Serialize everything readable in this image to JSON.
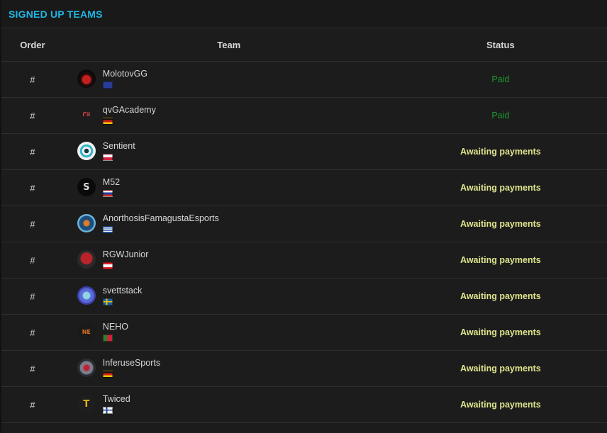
{
  "panel": {
    "title": "SIGNED UP TEAMS"
  },
  "columns": {
    "order": "Order",
    "team": "Team",
    "status": "Status"
  },
  "teams": [
    {
      "order": "#",
      "name": "MolotovGG",
      "logo": "molotov-logo",
      "flag": "eu-flag",
      "status": "Paid",
      "status_type": "paid"
    },
    {
      "order": "#",
      "name": "qvGAcademy",
      "logo": "qvg-logo",
      "flag": "germany-flag",
      "status": "Paid",
      "status_type": "paid"
    },
    {
      "order": "#",
      "name": "Sentient",
      "logo": "sentient-logo",
      "flag": "poland-flag",
      "status": "Awaiting payments",
      "status_type": "await"
    },
    {
      "order": "#",
      "name": "M52",
      "logo": "m52-logo",
      "flag": "russia-flag",
      "status": "Awaiting payments",
      "status_type": "await"
    },
    {
      "order": "#",
      "name": "AnorthosisFamagustaEsports",
      "logo": "anorthosis-logo",
      "flag": "greece-flag",
      "status": "Awaiting payments",
      "status_type": "await"
    },
    {
      "order": "#",
      "name": "RGWJunior",
      "logo": "rgw-logo",
      "flag": "lebanon-flag",
      "status": "Awaiting payments",
      "status_type": "await"
    },
    {
      "order": "#",
      "name": "svettstack",
      "logo": "svettstack-logo",
      "flag": "sweden-flag",
      "status": "Awaiting payments",
      "status_type": "await"
    },
    {
      "order": "#",
      "name": "NEHO",
      "logo": "neho-logo",
      "flag": "portugal-flag",
      "status": "Awaiting payments",
      "status_type": "await"
    },
    {
      "order": "#",
      "name": "InferuseSports",
      "logo": "inferuse-logo",
      "flag": "germany-flag",
      "status": "Awaiting payments",
      "status_type": "await"
    },
    {
      "order": "#",
      "name": "Twiced",
      "logo": "twiced-logo",
      "flag": "finland-flag",
      "status": "Awaiting payments",
      "status_type": "await"
    }
  ],
  "colors": {
    "title": "#1fb6e6",
    "paid": "#1f9a2e",
    "awaiting": "#dfe48c",
    "background": "#1c1c1c"
  }
}
